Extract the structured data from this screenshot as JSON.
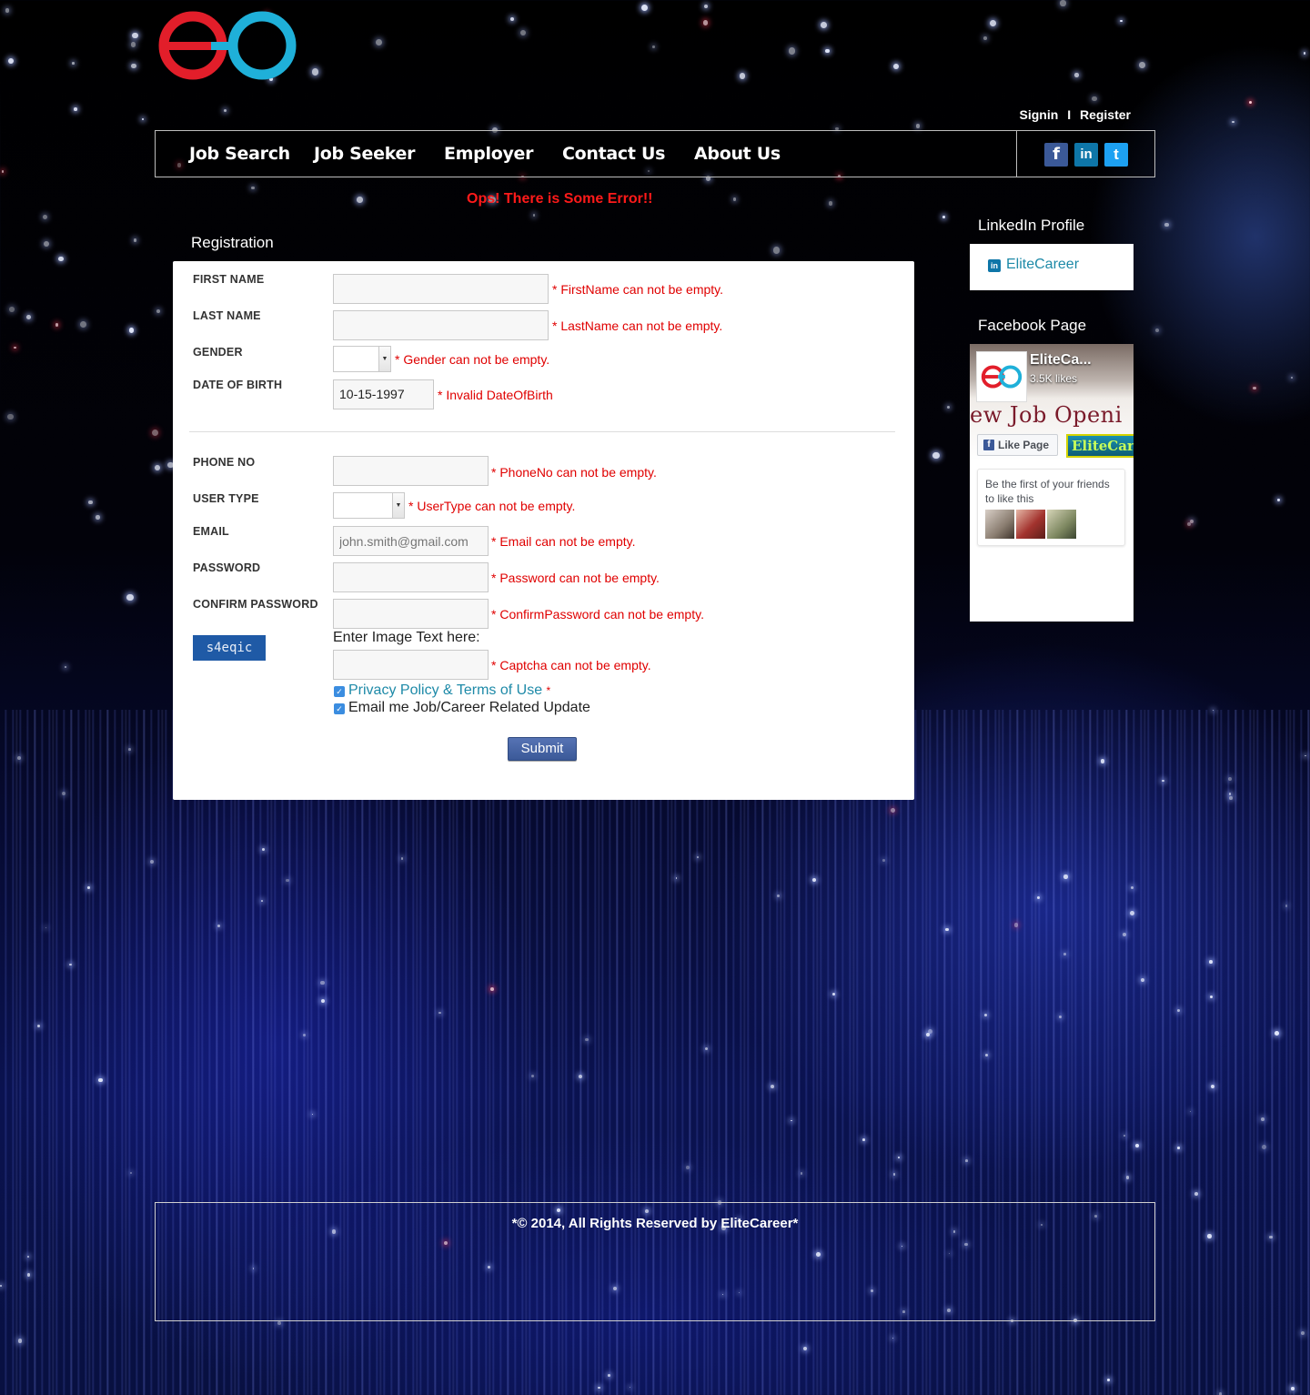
{
  "header": {
    "signin_label": "Signin",
    "separator": "I",
    "register_label": "Register"
  },
  "nav": {
    "items": [
      {
        "label": "Job Search"
      },
      {
        "label": "Job Seeker"
      },
      {
        "label": "Employer"
      },
      {
        "label": "Contact Us"
      },
      {
        "label": "About Us"
      }
    ],
    "social_icons": [
      "facebook-icon",
      "linkedin-icon",
      "twitter-icon"
    ],
    "social_glyphs": {
      "facebook": "f",
      "linkedin": "in",
      "twitter": "t"
    }
  },
  "error_banner": "Ops! There is Some Error!!",
  "registration": {
    "title": "Registration",
    "fields": {
      "first_name": {
        "label": "FIRST NAME",
        "value": "",
        "error": "* FirstName can not be empty."
      },
      "last_name": {
        "label": "LAST NAME",
        "value": "",
        "error": "* LastName can not be empty."
      },
      "gender": {
        "label": "GENDER",
        "value": "",
        "error": "* Gender can not be empty."
      },
      "date_of_birth": {
        "label": "DATE OF BIRTH",
        "value": "10-15-1997",
        "error": "* Invalid DateOfBirth"
      },
      "phone_no": {
        "label": "PHONE NO",
        "value": "",
        "error": "* PhoneNo can not be empty."
      },
      "user_type": {
        "label": "USER TYPE",
        "value": "",
        "error": "* UserType can not be empty."
      },
      "email": {
        "label": "EMAIL",
        "placeholder": "john.smith@gmail.com",
        "error": "* Email can not be empty."
      },
      "password": {
        "label": "PASSWORD",
        "value": "",
        "error": "* Password can not be empty."
      },
      "confirm_password": {
        "label": "CONFIRM PASSWORD",
        "value": "",
        "error": "* ConfirmPassword can not be empty."
      },
      "captcha": {
        "image_text": "s4eqic",
        "hint": "Enter Image Text here:",
        "value": "",
        "error": "* Captcha can not be empty."
      }
    },
    "checkboxes": {
      "privacy": {
        "label": "Privacy Policy & Terms of Use",
        "required_marker": "*",
        "checked": true
      },
      "email_updates": {
        "label": "Email me Job/Career Related Update",
        "checked": true
      }
    },
    "submit_label": "Submit",
    "select_arrow": "▼",
    "check_mark": "✓"
  },
  "sidebar": {
    "linkedin_title": "LinkedIn Profile",
    "linkedin_icon_text": "in",
    "linkedin_link": "EliteCareer",
    "facebook_title": "Facebook Page",
    "facebook_widget": {
      "page_name": "EliteCa...",
      "likes": "3.5K likes",
      "cover_text": "ew Job Openi",
      "like_button": "Like Page",
      "like_button_icon": "f",
      "elite_badge": "EliteCar",
      "friends_text": "Be the first of your friends to like this"
    }
  },
  "footer": {
    "text": "*© 2014, All Rights Reserved by EliteCareer*"
  },
  "colors": {
    "error_red": "#e00000",
    "link_teal": "#1e8aa8",
    "logo_red": "#e21e2a",
    "logo_blue": "#1fb0d9",
    "submit_blue": "#3b5998"
  }
}
